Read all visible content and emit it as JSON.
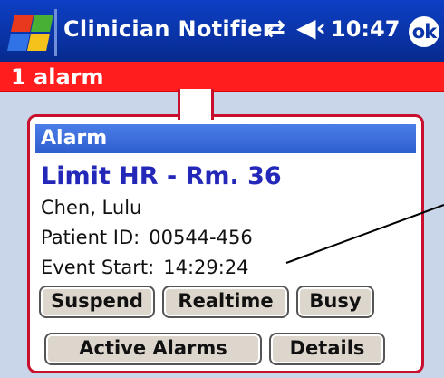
{
  "titlebar": {
    "app_title": "Clinician Notifier",
    "time": "10:47",
    "ok_label": "ok",
    "icons": [
      "windows-start-icon",
      "connectivity-icon",
      "volume-icon"
    ]
  },
  "banner": {
    "text": "1 alarm",
    "color": "#ff1d1d"
  },
  "popup": {
    "header": "Alarm",
    "alarm_title": "Limit HR - Rm. 36",
    "patient_name": "Chen, Lulu",
    "patient_id_label": "Patient ID:",
    "patient_id": "00544-456",
    "event_start_label": "Event Start:",
    "event_start": "14:29:24",
    "buttons": {
      "suspend": "Suspend",
      "realtime": "Realtime",
      "busy": "Busy",
      "active_alarms": "Active Alarms",
      "details": "Details"
    }
  },
  "colors": {
    "titlebar": "#0a34a8",
    "banner": "#ff1d1d",
    "alarm_title": "#2428b8",
    "popup_border": "#c8102e",
    "background": "#c9d6ea"
  }
}
